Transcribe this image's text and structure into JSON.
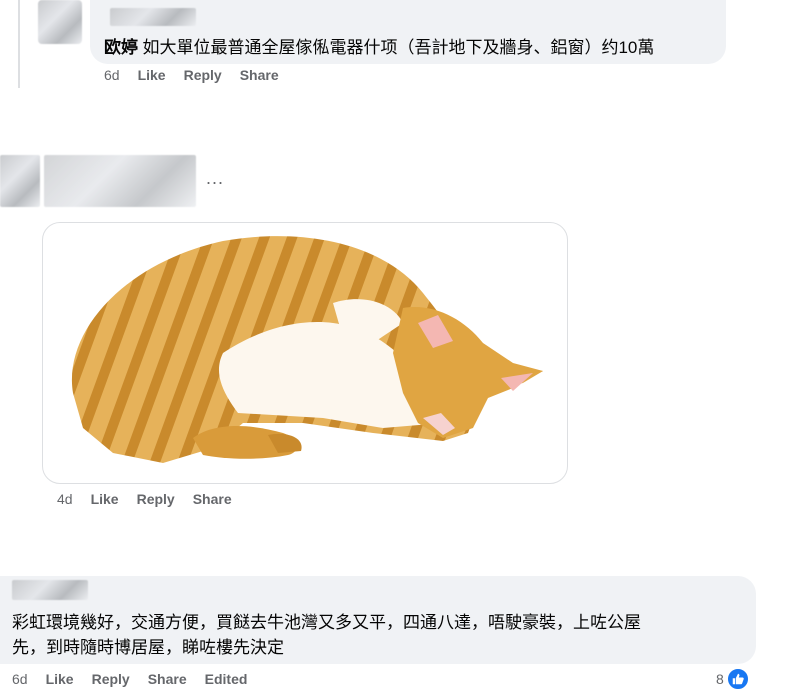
{
  "comment1": {
    "author": "欧婷",
    "text": "如大單位最普通全屋傢俬電器什项（吾計地下及牆身、鋁窗）约10萬",
    "time": "6d",
    "like": "Like",
    "reply": "Reply",
    "share": "Share"
  },
  "comment2": {
    "more": "...",
    "time": "4d",
    "like": "Like",
    "reply": "Reply",
    "share": "Share"
  },
  "comment3": {
    "text_line1": "彩虹環境幾好，交通方便，買餸去牛池灣又多又平，四通八達，唔駛豪裝，上咗公屋",
    "text_line2": "先，到時隨時博居屋，睇咗樓先決定",
    "time": "6d",
    "like": "Like",
    "reply": "Reply",
    "share": "Share",
    "edited": "Edited",
    "reaction_count": "8"
  },
  "colors": {
    "bubble": "#f0f2f5",
    "meta": "#65676b",
    "like_blue": "#1877f2",
    "cat_orange": "#e0a542",
    "cat_white": "#fdf7ee"
  },
  "icons": [
    "like-icon",
    "cat-sticker"
  ]
}
